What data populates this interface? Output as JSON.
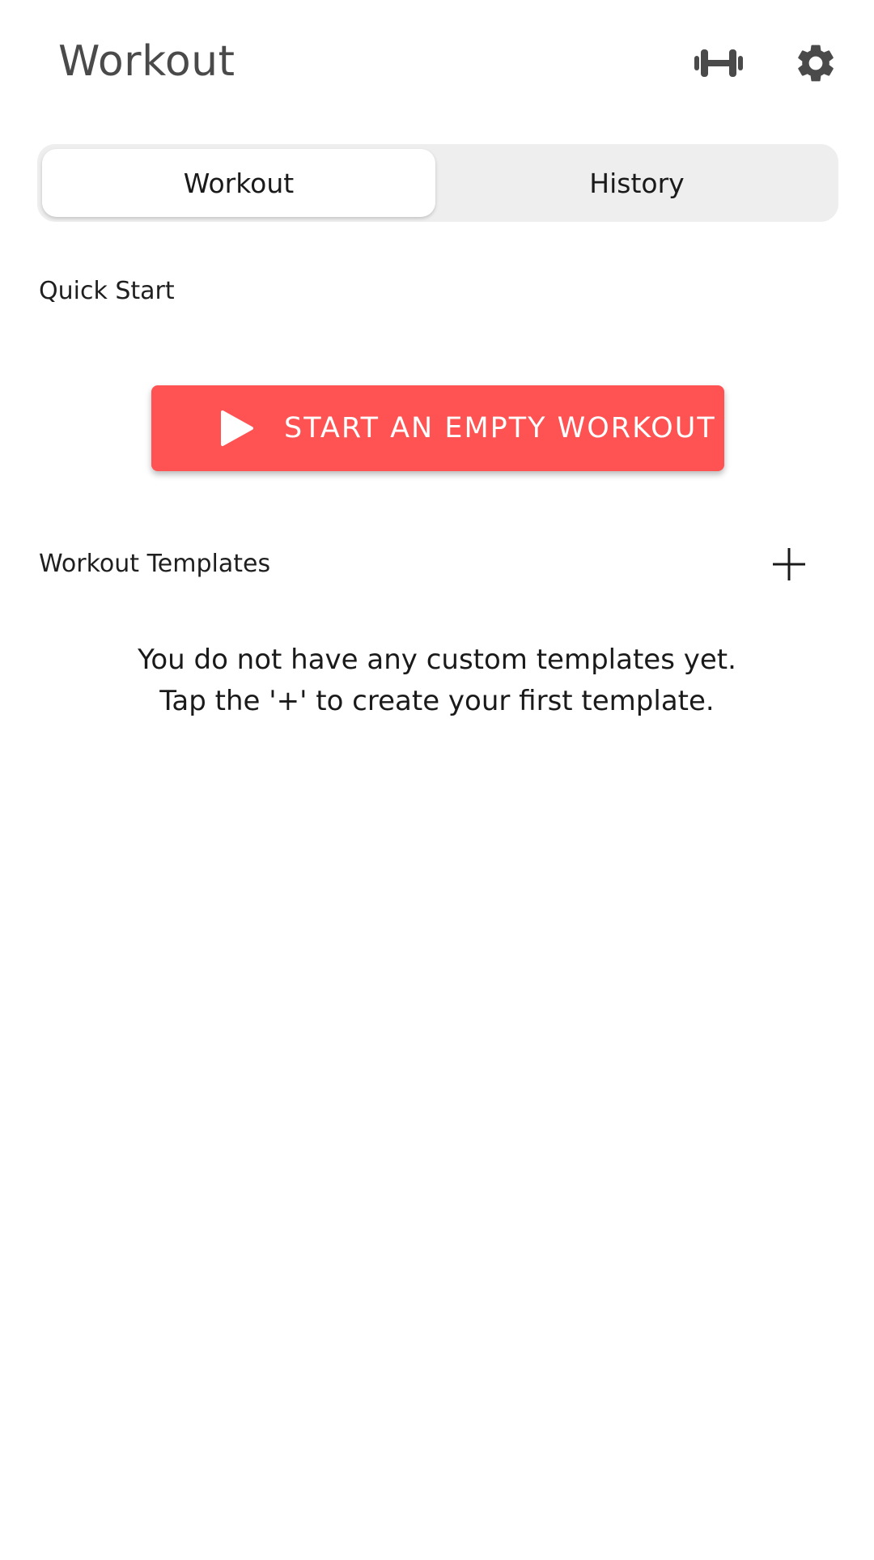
{
  "app_bar": {
    "title": "Workout",
    "exercises_icon": "dumbbell-icon",
    "settings_icon": "gear-icon"
  },
  "tabs": [
    {
      "label": "Workout",
      "selected": true
    },
    {
      "label": "History",
      "selected": false
    }
  ],
  "quick_start": {
    "label": "Quick Start",
    "button_label": "START AN EMPTY WORKOUT",
    "button_icon": "play-icon",
    "button_color": "#ff5252"
  },
  "templates": {
    "label": "Workout Templates",
    "add_icon": "plus-icon",
    "empty_line_1": "You do not have any custom templates yet.",
    "empty_line_2": "Tap the '+' to create your first template."
  }
}
